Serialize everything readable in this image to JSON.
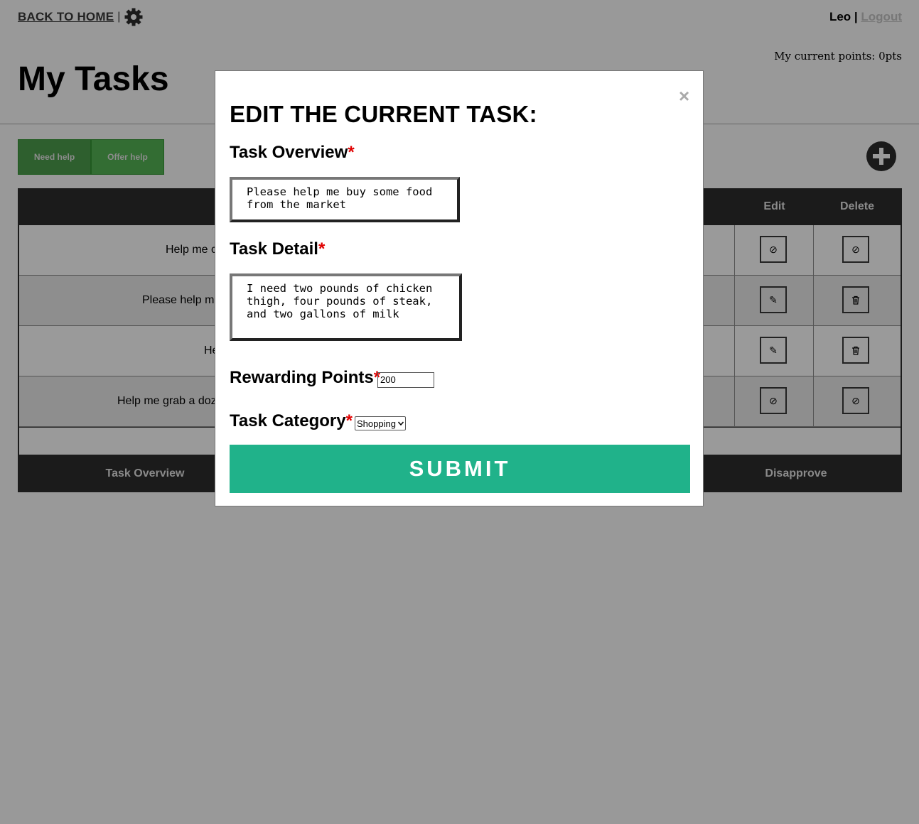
{
  "header": {
    "back_label": "BACK TO HOME",
    "separator": "|",
    "user_name": "Leo |",
    "logout_label": "Logout",
    "points_text": "My current points: 0pts"
  },
  "page": {
    "title": "My Tasks"
  },
  "tabs": [
    {
      "label": "Need help"
    },
    {
      "label": "Offer help"
    }
  ],
  "table": {
    "headers": {
      "edit": "Edit",
      "delete": "Delete"
    },
    "rows": [
      {
        "text": "Help me c",
        "edit_icon": "ban-icon",
        "delete_icon": "ban-icon"
      },
      {
        "text": "Please help me",
        "edit_icon": "edit-icon",
        "delete_icon": "trash-icon"
      },
      {
        "text": "He",
        "edit_icon": "edit-icon",
        "delete_icon": "trash-icon"
      },
      {
        "text": "Help me grab a doz",
        "edit_icon": "ban-icon",
        "delete_icon": "ban-icon"
      }
    ],
    "footer": {
      "overview": "Task Overview",
      "disapprove": "Disapprove"
    }
  },
  "modal": {
    "close_label": "×",
    "title": "EDIT THE CURRENT TASK:",
    "overview_label": "Task Overview",
    "overview_value": "Please help me buy some food from the market",
    "detail_label": "Task Detail",
    "detail_value": "I need two pounds of chicken thigh, four pounds of steak, and two gallons of milk",
    "points_label": "Rewarding Points",
    "points_value": "200",
    "category_label": "Task Category",
    "category_value": "Shopping",
    "required_mark": "*",
    "submit_label": "SUBMIT"
  },
  "colors": {
    "submit": "#20b28a",
    "required": "#e00000",
    "overlay_bg": "#999999"
  }
}
